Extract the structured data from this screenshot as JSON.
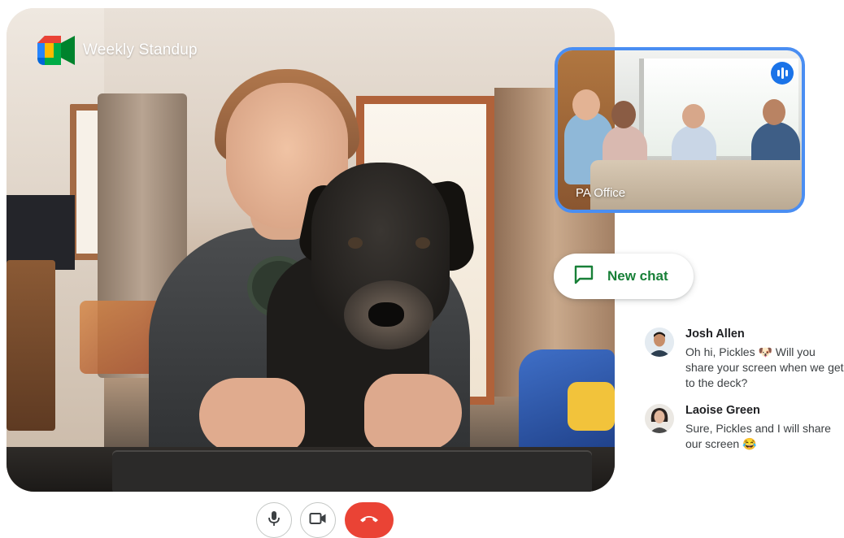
{
  "meeting": {
    "title": "Weekly Standup"
  },
  "side_tile": {
    "label": "PA Office",
    "indicator_icon": "speaking-indicator-icon"
  },
  "new_chat": {
    "label": "New chat",
    "icon": "chat-icon"
  },
  "messages": [
    {
      "name": "Josh Allen",
      "text": "Oh hi, Pickles 🐶 Will you share your screen when we get to the deck?"
    },
    {
      "name": "Laoise Green",
      "text": "Sure, Pickles and I will share our screen 😂"
    }
  ],
  "controls": {
    "microphone_icon": "microphone-icon",
    "camera_icon": "video-camera-icon",
    "end_call_icon": "end-call-icon"
  },
  "colors": {
    "accent_blue": "#4a8ef2",
    "chat_green": "#188038",
    "end_call_red": "#ea4335"
  }
}
